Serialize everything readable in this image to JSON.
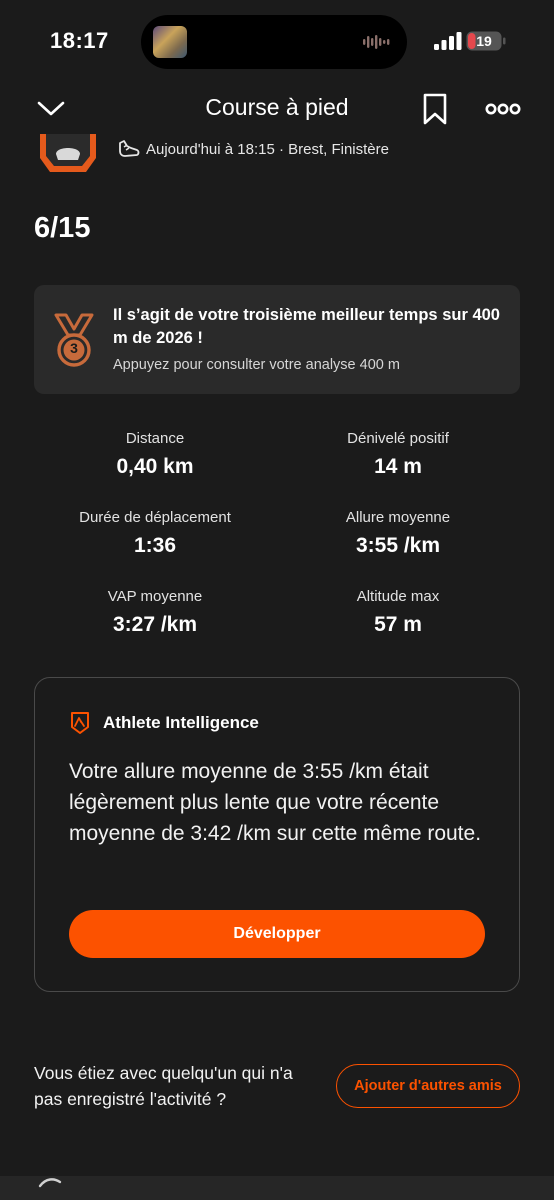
{
  "status_bar": {
    "time": "18:17",
    "battery_level": "19",
    "icons": [
      "signal-icon",
      "battery-icon",
      "audio-wave-icon"
    ]
  },
  "header": {
    "title": "Course à pied",
    "icons": [
      "chevron-down-icon",
      "bookmark-icon",
      "more-icon"
    ]
  },
  "activity": {
    "meta": "Aujourd'hui à 18:15 · Brest, Finistère",
    "meta_icon": "shoe-icon",
    "rank": "6/15"
  },
  "achievement": {
    "title": "Il s’agit de votre troisième meilleur temps sur 400 m de 2026 !",
    "subtitle": "Appuyez pour consulter votre analyse 400 m",
    "medal_number": "3",
    "icon": "medal-icon"
  },
  "stats": [
    {
      "label": "Distance",
      "value": "0,40 km"
    },
    {
      "label": "Dénivelé positif",
      "value": "14 m"
    },
    {
      "label": "Durée de déplacement",
      "value": "1:36"
    },
    {
      "label": "Allure moyenne",
      "value": "3:55 /km"
    },
    {
      "label": "VAP moyenne",
      "value": "3:27 /km"
    },
    {
      "label": "Altitude max",
      "value": "57 m"
    }
  ],
  "athlete_intelligence": {
    "title": "Athlete Intelligence",
    "text": "Votre allure moyenne de 3:55 /km était légèrement plus lente que votre récente moyenne de 3:42 /km sur cette même route.",
    "button_label": "Développer",
    "icon": "athlete-intelligence-icon"
  },
  "friends": {
    "text": "Vous étiez avec quelqu'un qui n'a pas enregistré l'activité ?",
    "button_label": "Ajouter d'autres amis"
  },
  "colors": {
    "background": "#1b1b1b",
    "card": "#2a2a2a",
    "accent": "#fc5200",
    "medal": "#c76a3b",
    "battery_low": "#e5484d"
  }
}
